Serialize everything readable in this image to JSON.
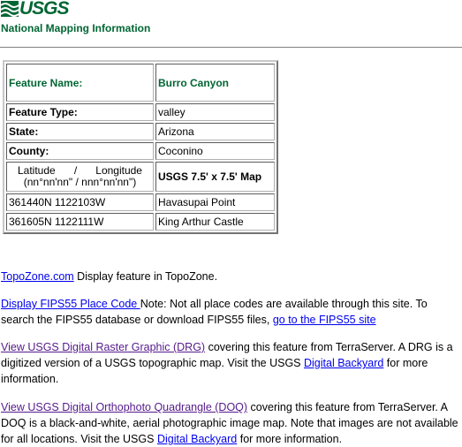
{
  "header": {
    "logo_text": "USGS",
    "subtitle": "National Mapping Information"
  },
  "feature": {
    "name_label": "Feature Name:",
    "name_value": "Burro Canyon",
    "type_label": "Feature Type:",
    "type_value": "valley",
    "state_label": "State:",
    "state_value": "Arizona",
    "county_label": "County:",
    "county_value": "Coconino",
    "latlon_label_lat": "Latitude",
    "latlon_label_sep": "/",
    "latlon_label_lon": "Longitude",
    "latlon_format": "(nn°nn'nn\" / nnn°nn'nn\")",
    "map_label": "USGS 7.5' x 7.5' Map",
    "maps": [
      {
        "coords": "361440N 1122103W",
        "name": "Havasupai Point"
      },
      {
        "coords": "361605N 1122111W",
        "name": "King Arthur Castle"
      }
    ]
  },
  "links": {
    "topozone": {
      "link": "TopoZone.com",
      "text": " Display feature in TopoZone."
    },
    "fips": {
      "link": "Display FIPS55 Place Code ",
      "text": "Note: Not all place codes are available through this site. To search the FIPS55 database or download FIPS55 files, ",
      "link2": "go to the FIPS55 site"
    },
    "drg": {
      "link": "View USGS Digital Raster Graphic (DRG)",
      "text": " covering this feature from TerraServer. A DRG is a digitized version of a USGS topographic map. Visit the USGS ",
      "link2": "Digital Backyard",
      "text2": " for more information."
    },
    "doq": {
      "link": "View USGS Digital Orthophoto Quadrangle (DOQ)",
      "text": " covering this feature from TerraServer. A DOQ is a black-and-white, aerial photographic image map. Note that images are not available for all locations. Visit the USGS ",
      "link2": "Digital Backyard",
      "text2": " for more information."
    }
  },
  "colors": {
    "brand_green": "#006633",
    "link": "#0000ee",
    "visited": "#551a8b"
  }
}
